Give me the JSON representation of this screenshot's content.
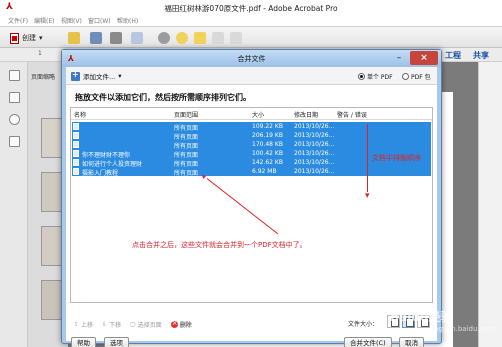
{
  "app": {
    "title": "福田红树林游070原文件.pdf - Adobe Acrobat Pro",
    "menu": [
      "文件(F)",
      "编辑(E)",
      "视图(V)",
      "窗口(W)",
      "帮助(H)"
    ],
    "create_label": "创建",
    "page_number": "1",
    "tools_label": "工程",
    "share_label": "共享",
    "thumbnail_label": "页面缩略"
  },
  "dialog": {
    "title": "合并文件",
    "minimize_glyph": "–",
    "close_glyph": "×",
    "add_files_label": "添加文件...",
    "output_options": [
      {
        "label": "单个 PDF",
        "selected": true
      },
      {
        "label": "PDF 包",
        "selected": false
      }
    ],
    "instructions": "拖放文件以添加它们，然后按所需顺序排列它们。",
    "columns": [
      "名称",
      "页面范围",
      "大小",
      "修改日期",
      "警告 / 错误"
    ],
    "files": [
      {
        "name": "",
        "page_range": "所有页面",
        "size": "109.22 KB",
        "modified": "2013/10/26..."
      },
      {
        "name": "",
        "page_range": "所有页面",
        "size": "206.19 KB",
        "modified": "2013/10/26..."
      },
      {
        "name": "",
        "page_range": "所有页面",
        "size": "170.48 KB",
        "modified": "2013/10/26..."
      },
      {
        "name": "你不理财财不理你",
        "page_range": "所有页面",
        "size": "100.42 KB",
        "modified": "2013/10/26..."
      },
      {
        "name": "如何进行个人投资理财",
        "page_range": "所有页面",
        "size": "142.62 KB",
        "modified": "2013/10/26..."
      },
      {
        "name": "摄影入门教程",
        "page_range": "所有页面",
        "size": "6.92 MB",
        "modified": "2013/10/26..."
      }
    ],
    "actions": [
      {
        "label": "上移",
        "enabled": false
      },
      {
        "label": "下移",
        "enabled": false
      },
      {
        "label": "选择页面",
        "enabled": false
      },
      {
        "label": "删除",
        "enabled": true
      }
    ],
    "file_size_label": "文件大小：",
    "help_button": "帮助",
    "options_button": "选项",
    "combine_button": "合并文件(C)",
    "cancel_button": "取消"
  },
  "annotations": {
    "sort_note": "文档中排版顺序",
    "merge_note": "点击合并之后，这些文件就会合并到一个PDF文档中了。",
    "color": "#e0202a"
  },
  "watermark": {
    "text": "Baidu经验",
    "sub": "jingyan.baidu.com"
  },
  "colors": {
    "row_selected": "#2b8be0",
    "dialog_frame": "#a9c9ea",
    "close_button": "#c7463b"
  }
}
